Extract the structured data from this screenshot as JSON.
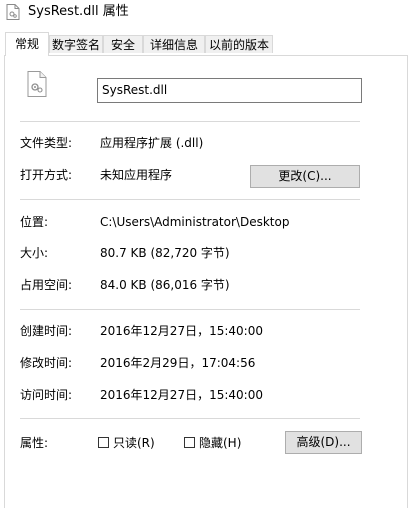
{
  "window": {
    "title": "SysRest.dll 属性"
  },
  "tabs": [
    {
      "label": "常规",
      "active": true
    },
    {
      "label": "数字签名",
      "active": false
    },
    {
      "label": "安全",
      "active": false
    },
    {
      "label": "详细信息",
      "active": false
    },
    {
      "label": "以前的版本",
      "active": false
    }
  ],
  "file": {
    "icon": "dll-file-icon",
    "name": "SysRest.dll"
  },
  "properties": {
    "file_type": {
      "label": "文件类型:",
      "value": "应用程序扩展 (.dll)"
    },
    "opens_with": {
      "label": "打开方式:",
      "value": "未知应用程序",
      "button": "更改(C)..."
    },
    "location": {
      "label": "位置:",
      "value": "C:\\Users\\Administrator\\Desktop"
    },
    "size": {
      "label": "大小:",
      "value": "80.7 KB (82,720 字节)"
    },
    "size_on_disk": {
      "label": "占用空间:",
      "value": "84.0 KB (86,016 字节)"
    },
    "created": {
      "label": "创建时间:",
      "value": "2016年12月27日，15:40:00"
    },
    "modified": {
      "label": "修改时间:",
      "value": "2016年2月29日，17:04:56"
    },
    "accessed": {
      "label": "访问时间:",
      "value": "2016年12月27日，15:40:00"
    }
  },
  "attributes": {
    "label": "属性:",
    "readonly": {
      "label": "只读(R)",
      "checked": false
    },
    "hidden": {
      "label": "隐藏(H)",
      "checked": false
    },
    "advanced_button": "高级(D)..."
  },
  "colors": {
    "border": "#d9d9d9",
    "button_bg": "#e1e1e1",
    "tab_bg": "#f0f0f0"
  }
}
